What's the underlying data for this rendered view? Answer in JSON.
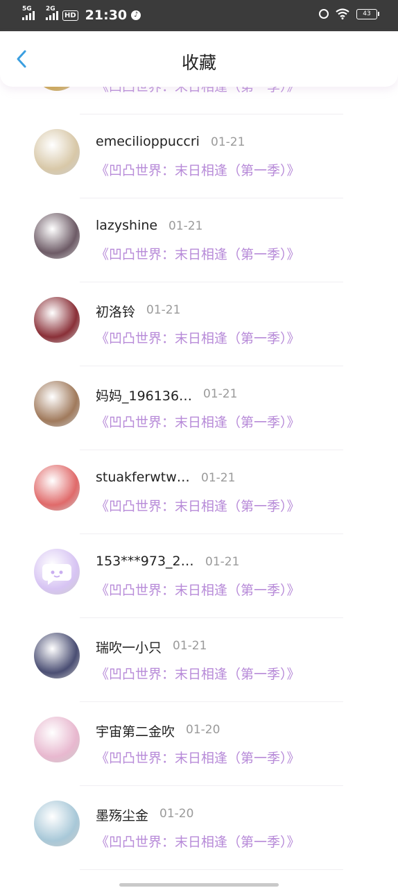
{
  "status_bar": {
    "net1": "5G",
    "net2": "2G",
    "hd": "HD",
    "time": "21:30",
    "battery": "43"
  },
  "header": {
    "title": "收藏"
  },
  "favorites": [
    {
      "user": "",
      "date": "",
      "work": "《凹凸世界：末日相逢（第一季）》",
      "avatar_color": "#c79a2a"
    },
    {
      "user": "emecilioppuccri",
      "date": "01-21",
      "work": "《凹凸世界：末日相逢（第一季）》",
      "avatar_color": "#d8c8a8"
    },
    {
      "user": "lazyshine",
      "date": "01-21",
      "work": "《凹凸世界：末日相逢（第一季）》",
      "avatar_color": "#6d5b66"
    },
    {
      "user": "初洛铃",
      "date": "01-21",
      "work": "《凹凸世界：末日相逢（第一季）》",
      "avatar_color": "#8a3038"
    },
    {
      "user": "妈妈_196136…",
      "date": "01-21",
      "work": "《凹凸世界：末日相逢（第一季）》",
      "avatar_color": "#a07a5c"
    },
    {
      "user": "stuakferwtw…",
      "date": "01-21",
      "work": "《凹凸世界：末日相逢（第一季）》",
      "avatar_color": "#e06a6a"
    },
    {
      "user": "153***973_2…",
      "date": "01-21",
      "work": "《凹凸世界：末日相逢（第一季）》",
      "avatar_color": "#d7c4f3"
    },
    {
      "user": "瑞吹一小只",
      "date": "01-21",
      "work": "《凹凸世界：末日相逢（第一季）》",
      "avatar_color": "#4a4e73"
    },
    {
      "user": "宇宙第二金吹",
      "date": "01-20",
      "work": "《凹凸世界：末日相逢（第一季）》",
      "avatar_color": "#e8b8cf"
    },
    {
      "user": "墨殇尘金",
      "date": "01-20",
      "work": "《凹凸世界：末日相逢（第一季）》",
      "avatar_color": "#a8c8d8"
    }
  ],
  "colors": {
    "accent": "#3b9fe0",
    "work_link": "#b78ad8",
    "status_bar_bg": "#3b3b3b"
  }
}
